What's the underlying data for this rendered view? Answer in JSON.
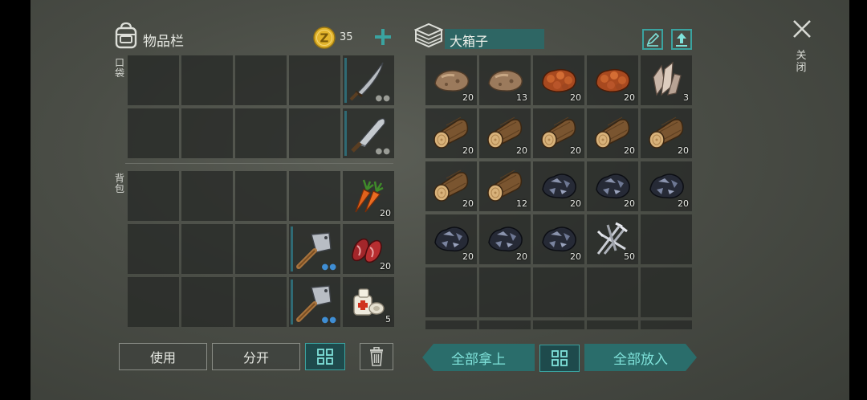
{
  "inventory": {
    "title": "物品栏",
    "coins": "35",
    "pocket_label": "口袋",
    "bag_label": "背包",
    "pocket_slots": [
      {
        "item": "",
        "count": ""
      },
      {
        "item": "",
        "count": ""
      },
      {
        "item": "",
        "count": ""
      },
      {
        "item": "",
        "count": ""
      },
      {
        "item": "curved-sword",
        "count": "",
        "durability": true,
        "dots": "grey"
      },
      {
        "item": "",
        "count": ""
      },
      {
        "item": "",
        "count": ""
      },
      {
        "item": "",
        "count": ""
      },
      {
        "item": "",
        "count": ""
      },
      {
        "item": "machete",
        "count": "",
        "durability": true,
        "dots": "grey"
      }
    ],
    "bag_slots": [
      {
        "item": "",
        "count": ""
      },
      {
        "item": "",
        "count": ""
      },
      {
        "item": "",
        "count": ""
      },
      {
        "item": "",
        "count": ""
      },
      {
        "item": "carrot",
        "count": "20"
      },
      {
        "item": "",
        "count": ""
      },
      {
        "item": "",
        "count": ""
      },
      {
        "item": "",
        "count": ""
      },
      {
        "item": "cleaver",
        "count": "",
        "durability": true,
        "dots": "blue"
      },
      {
        "item": "raw-meat",
        "count": "20"
      },
      {
        "item": "",
        "count": ""
      },
      {
        "item": "",
        "count": ""
      },
      {
        "item": "",
        "count": ""
      },
      {
        "item": "cleaver",
        "count": "",
        "durability": true,
        "dots": "blue"
      },
      {
        "item": "bandage",
        "count": "5"
      }
    ],
    "buttons": {
      "use": "使用",
      "split": "分开"
    }
  },
  "chest": {
    "title": "大箱子",
    "take_all": "全部拿上",
    "put_all": "全部放入",
    "slots": [
      {
        "item": "stone",
        "count": "20"
      },
      {
        "item": "stone",
        "count": "13"
      },
      {
        "item": "iron-ore",
        "count": "20"
      },
      {
        "item": "iron-ore",
        "count": "20"
      },
      {
        "item": "crystal",
        "count": "3"
      },
      {
        "item": "log",
        "count": "20"
      },
      {
        "item": "log",
        "count": "20"
      },
      {
        "item": "log",
        "count": "20"
      },
      {
        "item": "log",
        "count": "20"
      },
      {
        "item": "log",
        "count": "20"
      },
      {
        "item": "log",
        "count": "20"
      },
      {
        "item": "log",
        "count": "12"
      },
      {
        "item": "coal",
        "count": "20"
      },
      {
        "item": "coal",
        "count": "20"
      },
      {
        "item": "coal",
        "count": "20"
      },
      {
        "item": "coal",
        "count": "20"
      },
      {
        "item": "coal",
        "count": "20"
      },
      {
        "item": "coal",
        "count": "20"
      },
      {
        "item": "nails",
        "count": "50"
      },
      {
        "item": "",
        "count": ""
      },
      {
        "item": "",
        "count": ""
      },
      {
        "item": "",
        "count": ""
      },
      {
        "item": "",
        "count": ""
      },
      {
        "item": "",
        "count": ""
      },
      {
        "item": "",
        "count": ""
      },
      {
        "item": "",
        "count": ""
      },
      {
        "item": "",
        "count": ""
      },
      {
        "item": "",
        "count": ""
      },
      {
        "item": "",
        "count": ""
      },
      {
        "item": "",
        "count": ""
      }
    ]
  },
  "close_label": "关闭",
  "colors": {
    "accent": "#3aa3a0",
    "accent_dark": "#1e4a4c",
    "coin": "#e2b42c",
    "slot": "#262926"
  }
}
